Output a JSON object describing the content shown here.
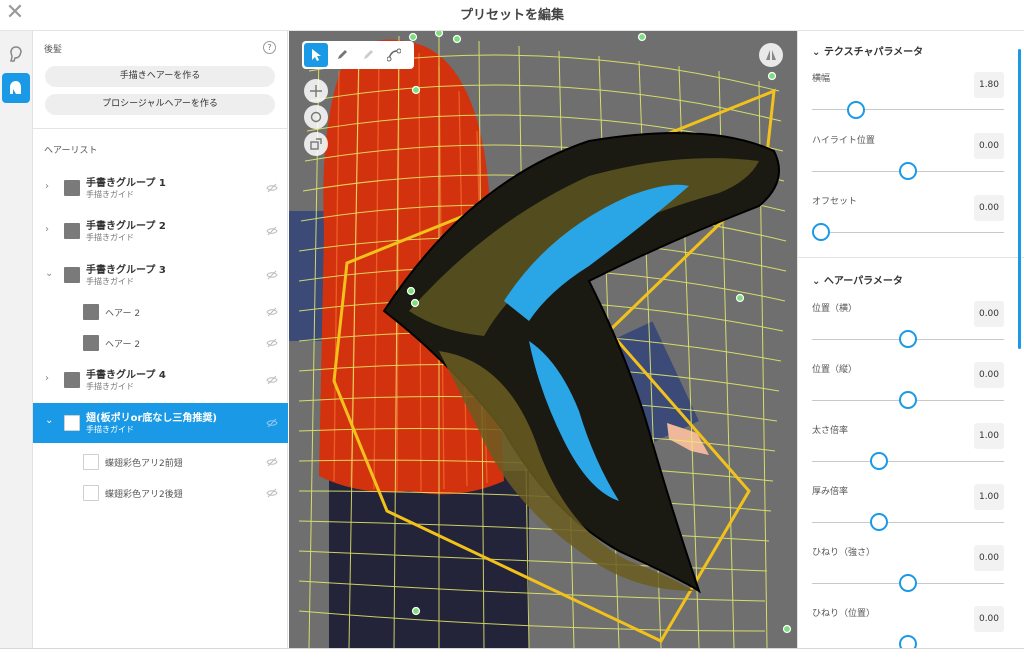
{
  "window": {
    "title": "プリセットを編集",
    "close_icon": "close-icon"
  },
  "rail": {
    "items": [
      {
        "icon": "hair-head-icon",
        "active": false
      },
      {
        "icon": "hair-preset-icon",
        "active": true
      }
    ]
  },
  "left": {
    "section_title": "後髪",
    "help_icon": "help-icon",
    "buttons": [
      "手描きヘアーを作る",
      "プロシージャルヘアーを作る"
    ],
    "list_title": "ヘアーリスト",
    "rows": [
      {
        "name": "手書きグループ 1",
        "sub": "手描きガイド",
        "expanded": false,
        "selected": false
      },
      {
        "name": "手書きグループ 2",
        "sub": "手描きガイド",
        "expanded": false,
        "selected": false
      },
      {
        "name": "手書きグループ 3",
        "sub": "手描きガイド",
        "expanded": true,
        "selected": false
      },
      {
        "name": "ヘアー 2",
        "child": true
      },
      {
        "name": "ヘアー 2",
        "child": true
      },
      {
        "name": "手書きグループ 4",
        "sub": "手描きガイド",
        "expanded": false,
        "selected": false
      },
      {
        "name": "翅(板ポリor底なし三角推奨)",
        "sub": "手描きガイド",
        "expanded": true,
        "selected": true
      },
      {
        "name": "蝶翅彩色アリ2前翅",
        "child": true
      },
      {
        "name": "蝶翅彩色アリ2後翅",
        "child": true
      }
    ]
  },
  "viewport": {
    "tools": [
      "select-arrow-icon",
      "pen-icon",
      "eraser-icon",
      "curve-edit-icon"
    ],
    "side_tools": [
      "move-icon",
      "rotate-icon",
      "scale-icon"
    ],
    "mirror_icon": "mirror-icon"
  },
  "right": {
    "texture_header": "テクスチャパラメータ",
    "texture_params": [
      {
        "label": "横幅",
        "value": "1.80",
        "level": 0.22
      },
      {
        "label": "ハイライト位置",
        "value": "0.00",
        "level": 0.5
      },
      {
        "label": "オフセット",
        "value": "0.00",
        "level": 0.0
      }
    ],
    "hair_header": "ヘアーパラメータ",
    "hair_params": [
      {
        "label": "位置（横）",
        "value": "0.00",
        "level": 0.5
      },
      {
        "label": "位置（縦）",
        "value": "0.00",
        "level": 0.5
      },
      {
        "label": "太さ倍率",
        "value": "1.00",
        "level": 0.35
      },
      {
        "label": "厚み倍率",
        "value": "1.00",
        "level": 0.35
      },
      {
        "label": "ひねり（強さ）",
        "value": "0.00",
        "level": 0.5
      },
      {
        "label": "ひねり（位置）",
        "value": "0.00",
        "level": 0.5
      }
    ]
  },
  "colors": {
    "accent": "#1a9ae6",
    "guide": "#f2c21b",
    "mesh": "#e8f06a",
    "hair": "#d8320f",
    "wing_blue": "#2aa6e6"
  }
}
